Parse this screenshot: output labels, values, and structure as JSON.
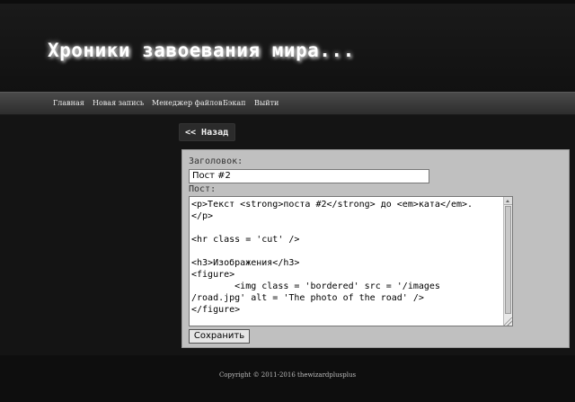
{
  "site": {
    "title": "Хроники завоевания мира..."
  },
  "nav": {
    "items": [
      {
        "label": "Главная"
      },
      {
        "label": "Новая запись"
      },
      {
        "label": "Менеджер файлов"
      },
      {
        "label": "Бэкап"
      },
      {
        "label": "Выйти"
      }
    ]
  },
  "back": {
    "label": "<< Назад"
  },
  "form": {
    "title_label": "Заголовок:",
    "title_value": "Пост #2",
    "post_label": "Пост:",
    "post_text": "<p>Текст <strong>поста #2</strong> до <em>ката</em>.\n</p>\n\n<hr class = 'cut' />\n\n<h3>Изображения</h3>\n<figure>\n        <img class = 'bordered' src = '/images\n/road.jpg' alt = 'The photo of the road' />\n</figure>",
    "save_label": "Сохранить"
  },
  "footer": {
    "copyright": "Copyright © 2011-2016 thewizardplusplus"
  }
}
